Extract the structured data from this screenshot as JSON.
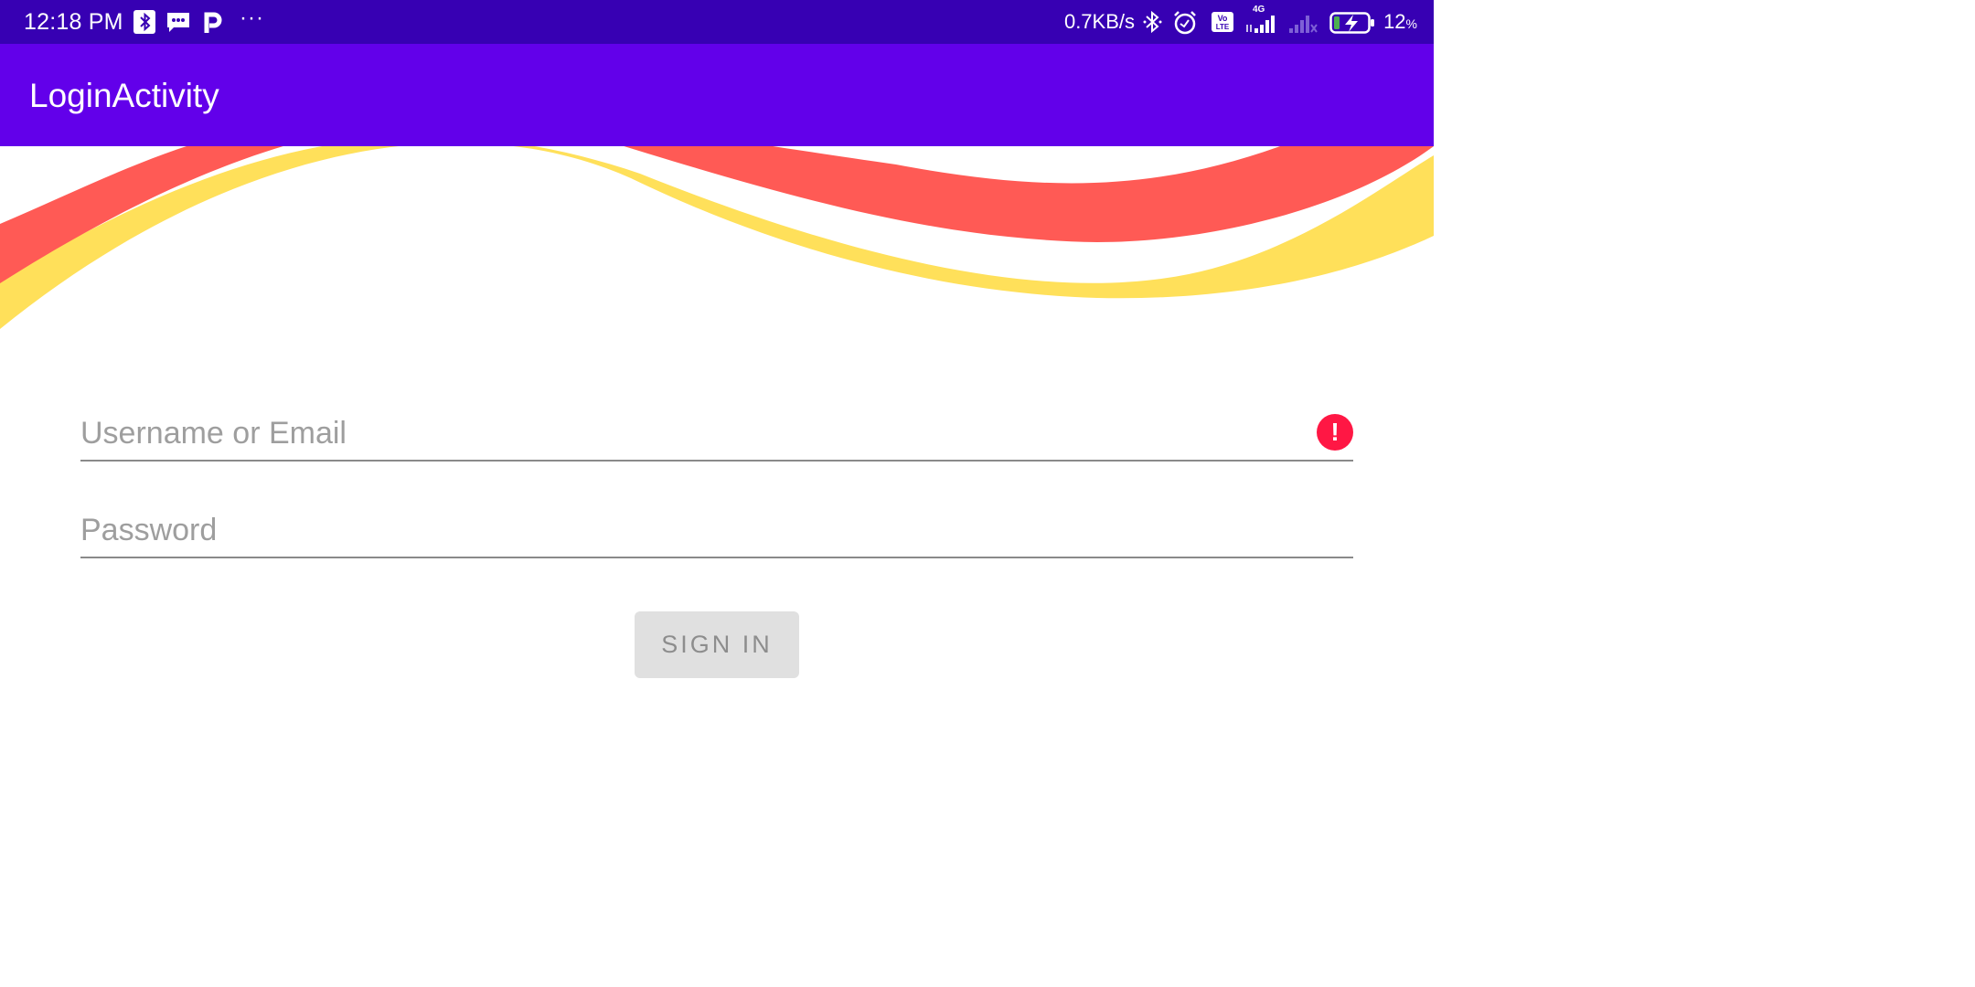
{
  "status_bar": {
    "time": "12:18 PM",
    "left_icons": [
      "bluetooth-notification-icon",
      "message-icon",
      "p-app-icon",
      "more-dots-icon"
    ],
    "more_label": "···",
    "network_speed": "0.7KB/s",
    "right_icons": [
      "bluetooth-icon",
      "alarm-icon",
      "volte-icon",
      "signal-4g-icon",
      "signal-no-service-icon",
      "battery-charging-icon"
    ],
    "volte_label": "Vo LTE",
    "network_type": "4G",
    "battery_percent": "12",
    "battery_unit": "%"
  },
  "app_bar": {
    "title": "LoginActivity"
  },
  "form": {
    "username_placeholder": "Username or Email",
    "username_error_glyph": "!",
    "password_placeholder": "Password",
    "signin_label": "SIGN IN"
  },
  "colors": {
    "status_bar": "#3700b3",
    "app_bar": "#6200ea",
    "wave_red": "#ff5a55",
    "wave_yellow": "#ffe05a",
    "error": "#ff1744",
    "button_bg": "#e0e0e0"
  }
}
